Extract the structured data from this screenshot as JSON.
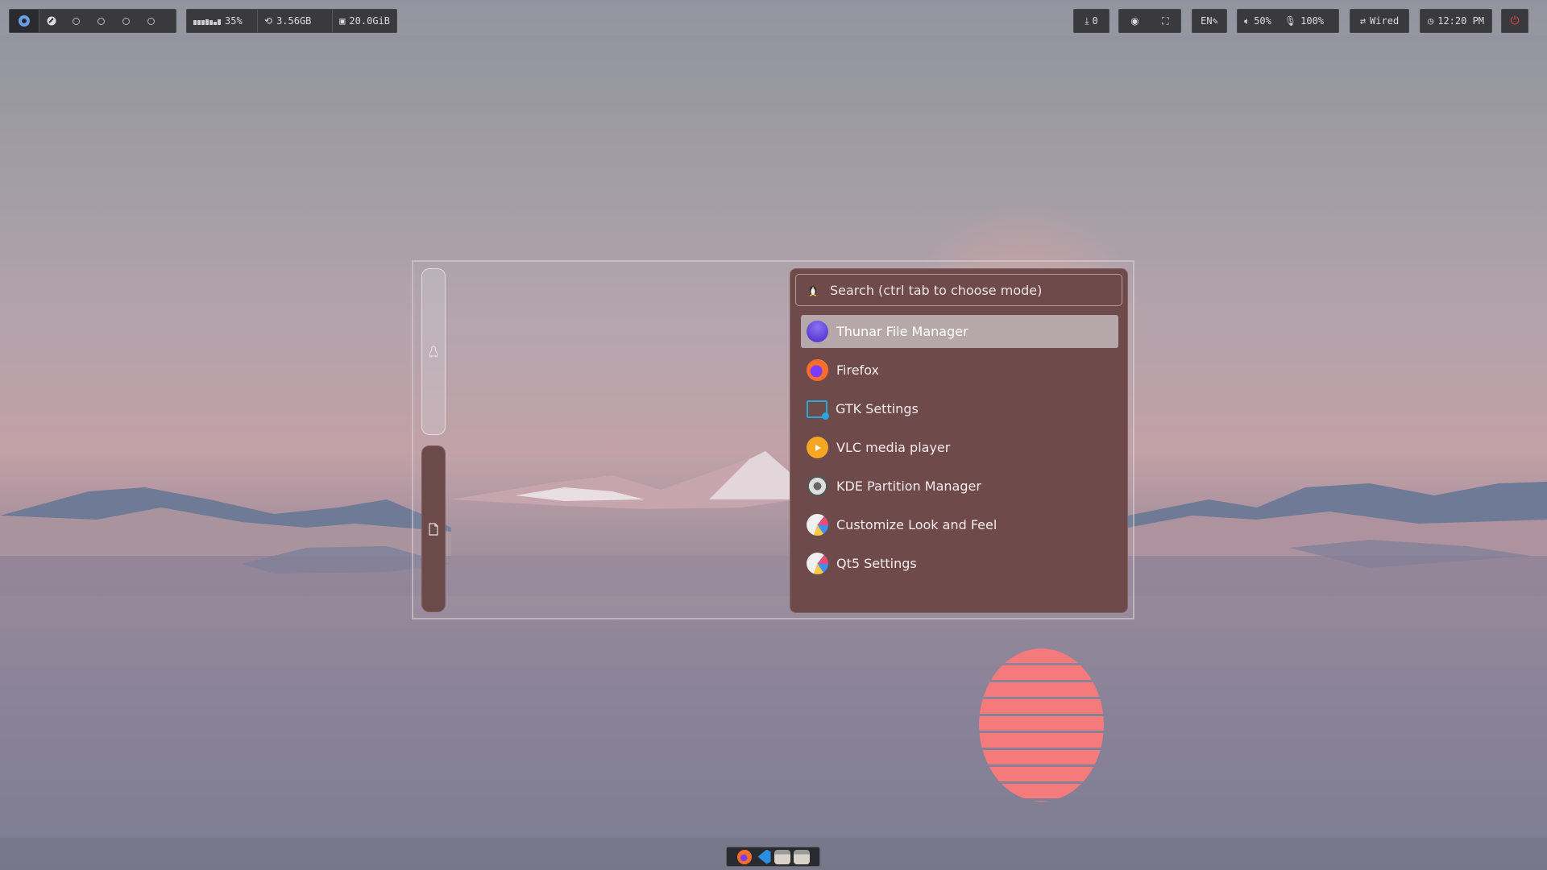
{
  "topbar": {
    "workspaces": [
      {
        "label": "",
        "active": true
      },
      {
        "label": "",
        "active": false
      },
      {
        "label": "",
        "active": false
      },
      {
        "label": "",
        "active": false
      },
      {
        "label": "",
        "active": false
      }
    ],
    "cpu_percent": "35%",
    "memory": "3.56GB",
    "disk": "20.0GiB",
    "downloads": "0",
    "keyboard_layout": "EN",
    "volume": "50%",
    "mic": "100%",
    "network": "Wired",
    "clock": "12:20 PM"
  },
  "launcher": {
    "search_placeholder": "Search (ctrl tab to choose mode)",
    "mode_icon": "tux-icon",
    "side_modes": [
      "tux-icon",
      "file-icon"
    ],
    "apps": [
      {
        "name": "Thunar File Manager",
        "icon": "thunar-icon",
        "selected": true
      },
      {
        "name": "Firefox",
        "icon": "firefox-icon",
        "selected": false
      },
      {
        "name": "GTK Settings",
        "icon": "gtk-settings-icon",
        "selected": false
      },
      {
        "name": "VLC media player",
        "icon": "vlc-icon",
        "selected": false
      },
      {
        "name": "KDE Partition Manager",
        "icon": "partition-manager-icon",
        "selected": false
      },
      {
        "name": "Customize Look and Feel",
        "icon": "look-and-feel-icon",
        "selected": false
      },
      {
        "name": "Qt5 Settings",
        "icon": "qt5-settings-icon",
        "selected": false
      }
    ]
  },
  "dock": {
    "apps": [
      "firefox-icon",
      "vscode-icon",
      "terminal-icon",
      "terminal-icon"
    ]
  },
  "colors": {
    "panel_bg": "#6e4a4a",
    "selected_bg": "#b6a8aa",
    "sun": "#ff7a7a",
    "power": "#e04646"
  }
}
